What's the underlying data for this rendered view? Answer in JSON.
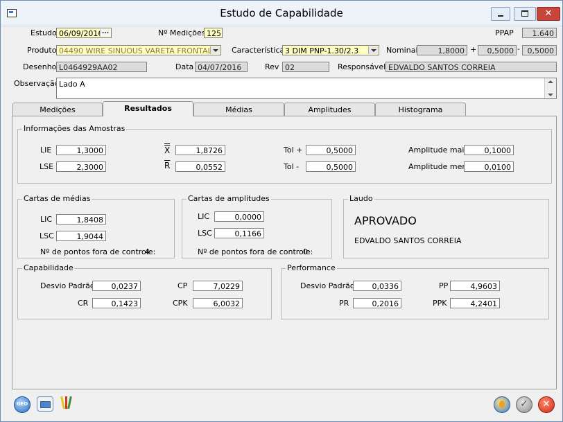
{
  "window": {
    "title": "Estudo de Capabilidade"
  },
  "header": {
    "estudo_label": "Estudo",
    "estudo_value": "06/09/2016",
    "nmedicoes_label": "Nº Medições",
    "nmedicoes_value": "125",
    "ppap_label": "PPAP",
    "ppap_value": "1.640",
    "produto_label": "Produto",
    "produto_value": "04490  WIRE SINUOUS VARETA FRONTAL",
    "caracteristica_label": "Característica",
    "caracteristica_value": "3  DIM  PNP-1.30/2.3",
    "nominal_label": "Nominal",
    "nominal_value": "1,8000",
    "plus_sign": "+",
    "tol_plus_value": "0,5000",
    "minus_sign": "-",
    "tol_minus_value": "0,5000",
    "desenho_label": "Desenho",
    "desenho_value": "L0464929AA02",
    "data_label": "Data",
    "data_value": "04/07/2016",
    "rev_label": "Rev",
    "rev_value": "02",
    "responsavel_label": "Responsável",
    "responsavel_value": "EDVALDO SANTOS CORREIA",
    "observacao_label": "Observação",
    "observacao_value": "Lado A"
  },
  "tabs": [
    {
      "label": "Medições"
    },
    {
      "label": "Resultados",
      "active": true
    },
    {
      "label": "Médias"
    },
    {
      "label": "Amplitudes"
    },
    {
      "label": "Histograma"
    }
  ],
  "amostras": {
    "title": "Informações das Amostras",
    "lie_label": "LIE",
    "lie_value": "1,3000",
    "lse_label": "LSE",
    "lse_value": "2,3000",
    "xbarbar_label": "X",
    "xbarbar_value": "1,8726",
    "rbar_label": "R",
    "rbar_value": "0,0552",
    "tolplus_label": "Tol +",
    "tolplus_value": "0,5000",
    "tolminus_label": "Tol -",
    "tolminus_value": "0,5000",
    "ampmaior_label": "Amplitude maior",
    "ampmaior_value": "0,1000",
    "ampmenor_label": "Amplitude menor",
    "ampmenor_value": "0,0100"
  },
  "medias": {
    "title": "Cartas de médias",
    "lic_label": "LIC",
    "lic_value": "1,8408",
    "lsc_label": "LSC",
    "lsc_value": "1,9044",
    "fora_label": "Nº de pontos fora de controle:",
    "fora_value": "4"
  },
  "amplitudes": {
    "title": "Cartas de amplitudes",
    "lic_label": "LIC",
    "lic_value": "0,0000",
    "lsc_label": "LSC",
    "lsc_value": "0,1166",
    "fora_label": "Nº de pontos fora de controle:",
    "fora_value": "0"
  },
  "laudo": {
    "title": "Laudo",
    "status": "APROVADO",
    "responsavel": "EDVALDO SANTOS CORREIA"
  },
  "capabilidade": {
    "title": "Capabilidade",
    "desvio_label": "Desvio Padrão",
    "desvio_value": "0,0237",
    "cp_label": "CP",
    "cp_value": "7,0229",
    "cr_label": "CR",
    "cr_value": "0,1423",
    "cpk_label": "CPK",
    "cpk_value": "6,0032"
  },
  "performance": {
    "title": "Performance",
    "desvio_label": "Desvio Padrão",
    "desvio_value": "0,0336",
    "pp_label": "PP",
    "pp_value": "4,9603",
    "pr_label": "PR",
    "pr_value": "0,2016",
    "ppk_label": "PPK",
    "ppk_value": "4,2401"
  },
  "toolbar": {
    "ged_label": "GED"
  }
}
